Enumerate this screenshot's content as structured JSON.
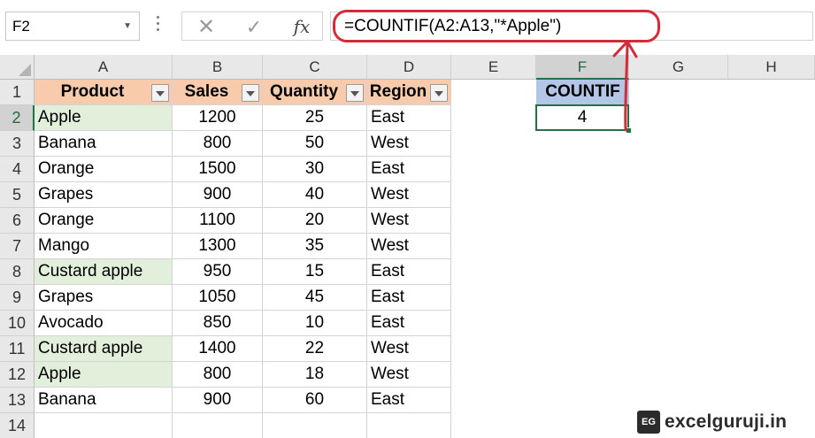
{
  "formula_bar": {
    "name_box": "F2",
    "formula": "=COUNTIF(A2:A13,\"*Apple\")",
    "cancel_icon": "✕",
    "enter_icon": "✓",
    "fx_icon": "fx"
  },
  "columns": [
    "A",
    "B",
    "C",
    "D",
    "E",
    "F",
    "G",
    "H"
  ],
  "rows": [
    "1",
    "2",
    "3",
    "4",
    "5",
    "6",
    "7",
    "8",
    "9",
    "10",
    "11",
    "12",
    "13",
    "14"
  ],
  "table": {
    "headers": [
      "Product",
      "Sales",
      "Quantity",
      "Region"
    ],
    "rows": [
      {
        "product": "Apple",
        "sales": "1200",
        "quantity": "25",
        "region": "East",
        "highlight": true
      },
      {
        "product": "Banana",
        "sales": "800",
        "quantity": "50",
        "region": "West",
        "highlight": false
      },
      {
        "product": "Orange",
        "sales": "1500",
        "quantity": "30",
        "region": "East",
        "highlight": false
      },
      {
        "product": "Grapes",
        "sales": "900",
        "quantity": "40",
        "region": "West",
        "highlight": false
      },
      {
        "product": "Orange",
        "sales": "1100",
        "quantity": "20",
        "region": "West",
        "highlight": false
      },
      {
        "product": "Mango",
        "sales": "1300",
        "quantity": "35",
        "region": "West",
        "highlight": false
      },
      {
        "product": "Custard apple",
        "sales": "950",
        "quantity": "15",
        "region": "East",
        "highlight": true
      },
      {
        "product": "Grapes",
        "sales": "1050",
        "quantity": "45",
        "region": "East",
        "highlight": false
      },
      {
        "product": "Avocado",
        "sales": "850",
        "quantity": "10",
        "region": "East",
        "highlight": false
      },
      {
        "product": "Custard apple",
        "sales": "1400",
        "quantity": "22",
        "region": "West",
        "highlight": true
      },
      {
        "product": "Apple",
        "sales": "800",
        "quantity": "18",
        "region": "West",
        "highlight": true
      },
      {
        "product": "Banana",
        "sales": "900",
        "quantity": "60",
        "region": "East",
        "highlight": false
      }
    ]
  },
  "countif": {
    "header": "COUNTIF",
    "value": "4"
  },
  "active_cell": {
    "column": "F",
    "row": "2"
  },
  "colors": {
    "header_fill": "#f8cbad",
    "highlight_fill": "#e2efda",
    "countif_fill": "#b4c6e7",
    "annotation_red": "#d42b38",
    "excel_green": "#217346"
  },
  "watermark": {
    "badge": "EG",
    "text": "excelguruji.in"
  }
}
